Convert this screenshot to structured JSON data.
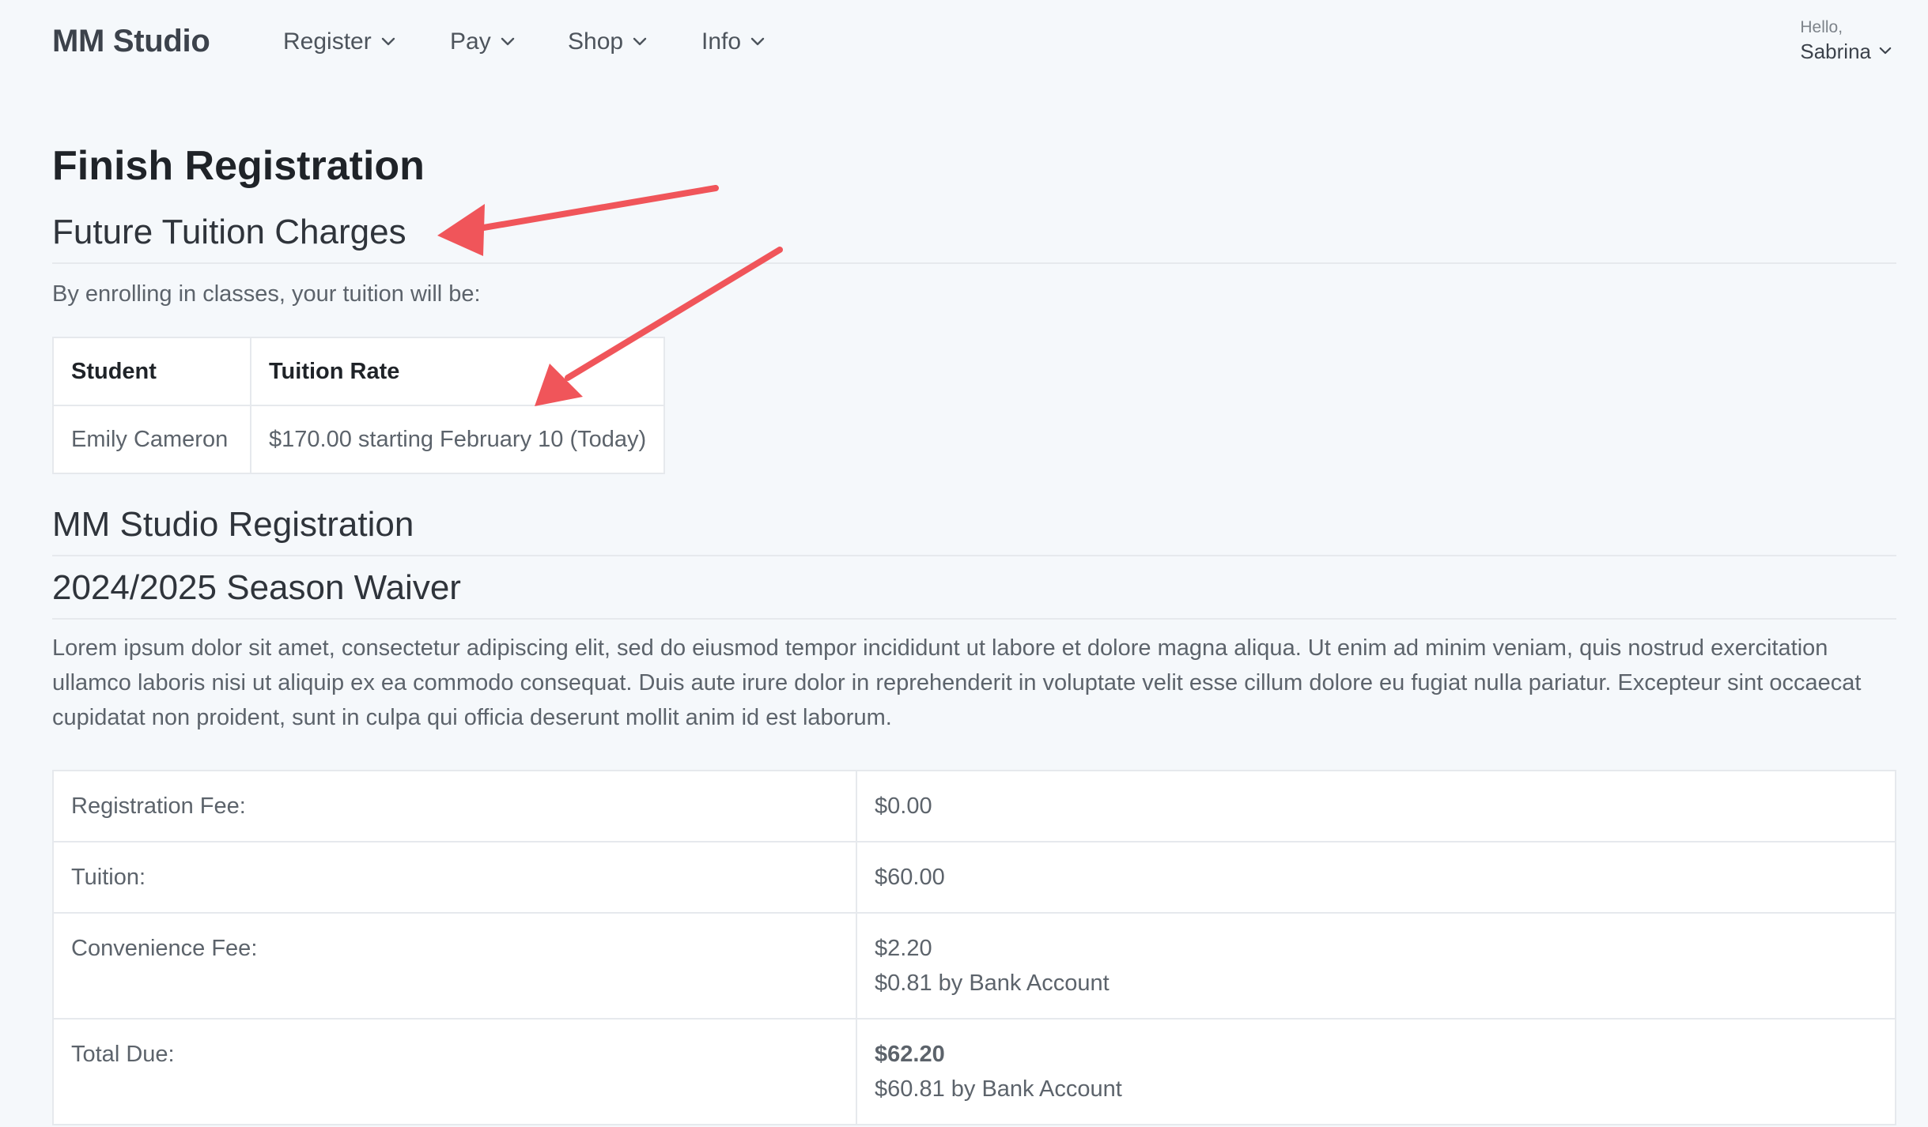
{
  "nav": {
    "brand": "MM Studio",
    "items": [
      {
        "label": "Register"
      },
      {
        "label": "Pay"
      },
      {
        "label": "Shop"
      },
      {
        "label": "Info"
      }
    ],
    "greeting": "Hello,",
    "user_name": "Sabrina"
  },
  "page": {
    "title": "Finish Registration"
  },
  "future_tuition": {
    "heading": "Future Tuition Charges",
    "lead": "By enrolling in classes, your tuition will be:",
    "table": {
      "headers": [
        "Student",
        "Tuition Rate"
      ],
      "rows": [
        [
          "Emily Cameron",
          "$170.00 starting February 10 (Today)"
        ]
      ]
    }
  },
  "registration": {
    "heading": "MM Studio Registration"
  },
  "waiver": {
    "heading": "2024/2025 Season Waiver",
    "text": "Lorem ipsum dolor sit amet, consectetur adipiscing elit, sed do eiusmod tempor incididunt ut labore et dolore magna aliqua. Ut enim ad minim veniam, quis nostrud exercitation ullamco laboris nisi ut aliquip ex ea commodo consequat. Duis aute irure dolor in reprehenderit in voluptate velit esse cillum dolore eu fugiat nulla pariatur. Excepteur sint occaecat cupidatat non proident, sunt in culpa qui officia deserunt mollit anim id est laborum."
  },
  "fees": {
    "registration_fee_label": "Registration Fee:",
    "registration_fee_value": "$0.00",
    "tuition_label": "Tuition:",
    "tuition_value": "$60.00",
    "convenience_fee_label": "Convenience Fee:",
    "convenience_fee_value": "$2.20",
    "convenience_fee_bank": "$0.81 by Bank Account",
    "total_label": "Total Due:",
    "total_value": "$62.20",
    "total_bank": "$60.81 by Bank Account"
  },
  "colors": {
    "background": "#f5f8fb",
    "annotation_arrow": "#f0555a"
  },
  "icons": [
    "chevron-down-icon"
  ]
}
